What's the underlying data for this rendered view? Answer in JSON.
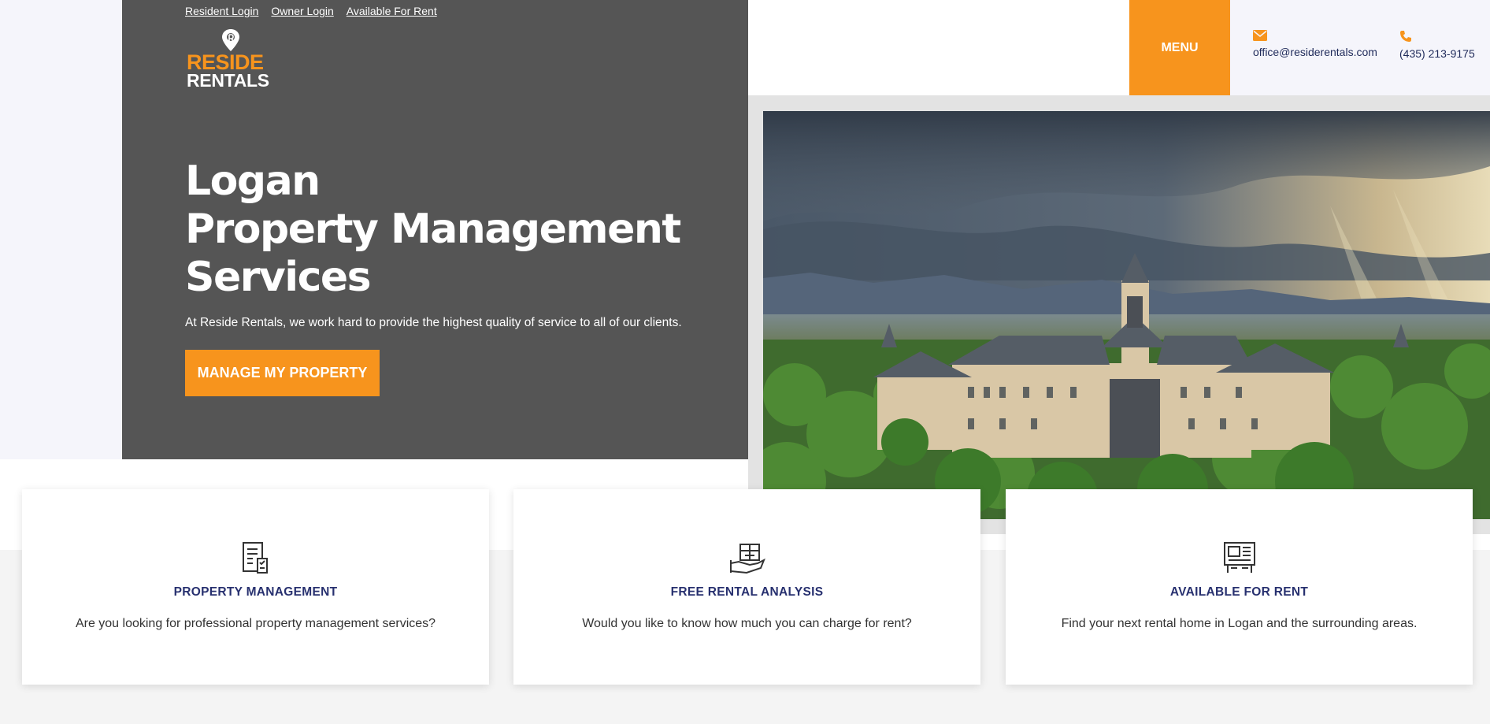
{
  "top_links": [
    "Resident Login",
    "Owner Login",
    "Available For Rent"
  ],
  "logo": {
    "line1": "RESIDE",
    "line2": "RENTALS"
  },
  "menu_label": "MENU",
  "contact": {
    "email": "office@residerentals.com",
    "phone": "(435) 213-9175"
  },
  "hero": {
    "title_lines": [
      "Logan",
      "Property Management",
      "Services"
    ],
    "subtitle": "At Reside Rentals, we work hard to provide the highest quality of service to all of our clients.",
    "cta_label": "MANAGE MY PROPERTY"
  },
  "cards": [
    {
      "title": "PROPERTY MANAGEMENT",
      "description": "Are you looking for professional property management services?",
      "icon": "checklist-icon"
    },
    {
      "title": "FREE RENTAL ANALYSIS",
      "description": "Would you like to know how much you can charge for rent?",
      "icon": "house-in-hand-icon"
    },
    {
      "title": "AVAILABLE FOR RENT",
      "description": "Find your next rental home in Logan and the surrounding areas.",
      "icon": "listing-board-icon"
    }
  ],
  "colors": {
    "accent": "#f7941d",
    "hero_bg": "#555555",
    "navy": "#27306f"
  }
}
